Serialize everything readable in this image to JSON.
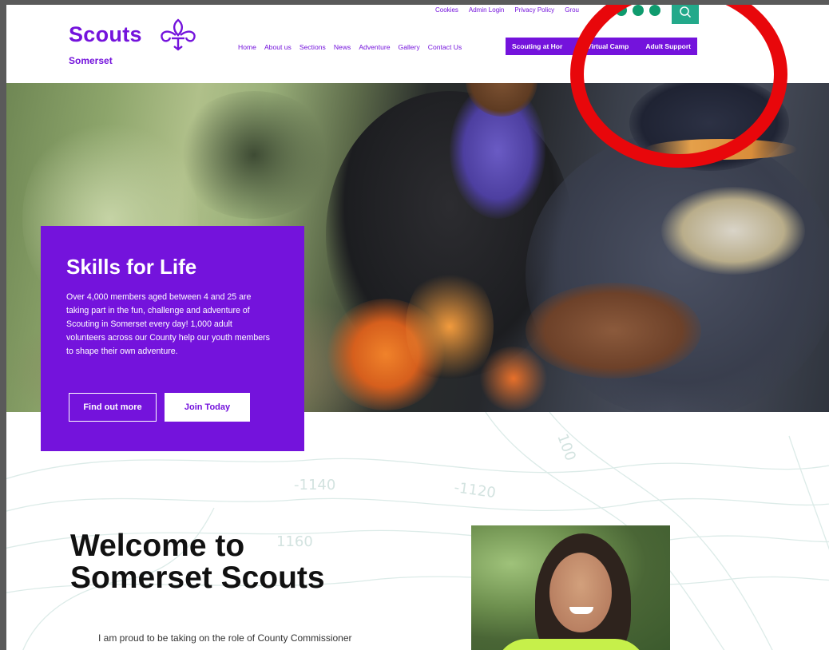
{
  "header": {
    "logo_word": "Scouts",
    "logo_sub": "Somerset",
    "util_links": [
      "Cookies",
      "Admin Login",
      "Privacy Policy",
      "Grou"
    ],
    "social_icons": [
      "facebook-icon",
      "twitter-icon",
      "instagram-icon"
    ],
    "nav_items": [
      "Home",
      "About us",
      "Sections",
      "News",
      "Adventure",
      "Gallery",
      "Contact Us"
    ],
    "cta_items": [
      "Scouting at Hor",
      "Virtual Camp",
      "Adult Support"
    ]
  },
  "hero": {
    "title": "Skills for Life",
    "text": "Over 4,000 members aged between 4 and 25 are taking part in the fun, challenge and adventure of Scouting in Somerset every day! 1,000 adult volunteers across our County help our youth members to shape their own adventure.",
    "find_out_label": "Find out more",
    "join_label": "Join Today"
  },
  "contour_labels": [
    "-1140",
    "-1120",
    "1160",
    "100"
  ],
  "welcome": {
    "title_line1": "Welcome to",
    "title_line2": "Somerset Scouts",
    "body": "I am proud to be taking on the role of County Commissioner"
  },
  "colors": {
    "brand_purple": "#7413dc",
    "teal": "#23a98a",
    "social_green": "#0f9b6e",
    "annotation_red": "#e8070b"
  }
}
